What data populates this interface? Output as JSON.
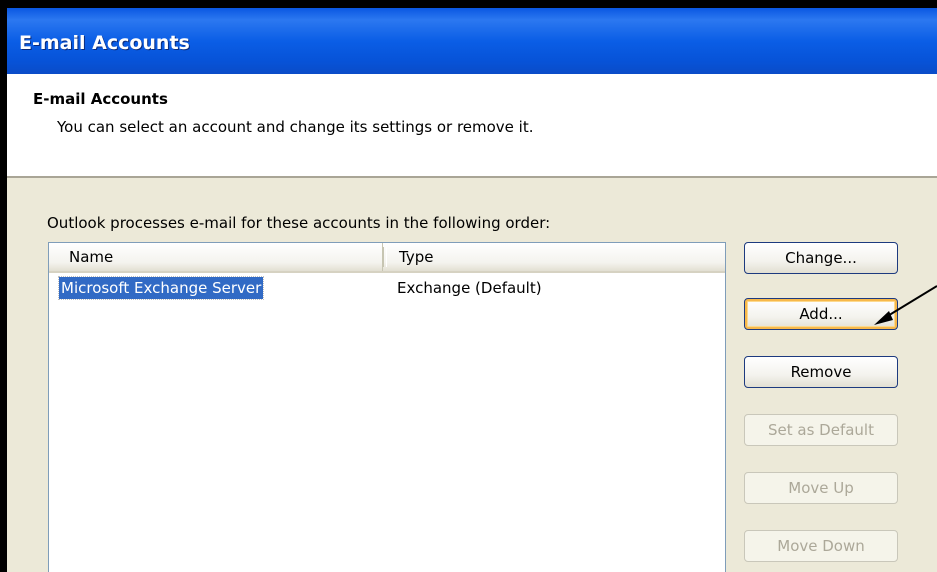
{
  "window": {
    "title": "E-mail Accounts"
  },
  "header": {
    "title": "E-mail Accounts",
    "subtitle": "You can select an account and change its settings or remove it."
  },
  "main": {
    "order_label": "Outlook processes e-mail for these accounts in the following order:",
    "list": {
      "columns": [
        "Name",
        "Type"
      ],
      "rows": [
        {
          "name": "Microsoft Exchange Server",
          "type": "Exchange (Default)",
          "selected": true
        }
      ]
    },
    "buttons": {
      "change": "Change...",
      "add": "Add...",
      "remove": "Remove",
      "set_default": "Set as Default",
      "move_up": "Move Up",
      "move_down": "Move Down"
    }
  },
  "colors": {
    "titlebar": "#0a57e2",
    "dialog_body": "#ece9d8",
    "selection": "#316ac5",
    "default_button_ring": "#f7b84a",
    "disabled_text": "#aca899"
  },
  "annotation": {
    "arrow_target": "Add..."
  }
}
